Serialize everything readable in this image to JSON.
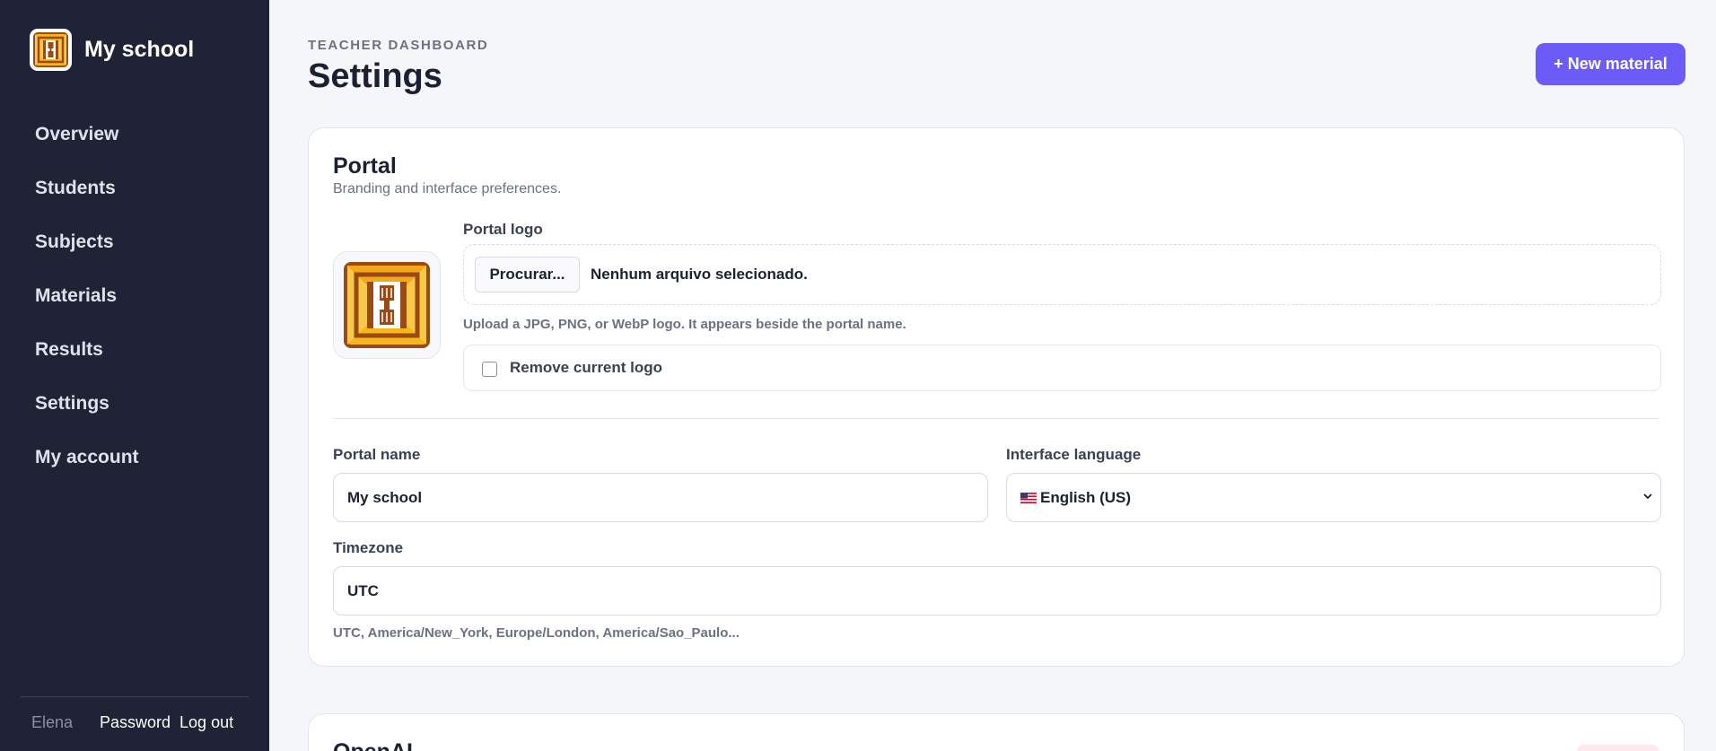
{
  "sidebar": {
    "brand_name": "My school",
    "items": [
      {
        "label": "Overview"
      },
      {
        "label": "Students"
      },
      {
        "label": "Subjects"
      },
      {
        "label": "Materials"
      },
      {
        "label": "Results"
      },
      {
        "label": "Settings"
      },
      {
        "label": "My account"
      }
    ],
    "footer": {
      "user": "Elena",
      "password_link": "Password",
      "logout_link": "Log out"
    }
  },
  "header": {
    "eyebrow": "TEACHER DASHBOARD",
    "title": "Settings",
    "new_button": "+ New material"
  },
  "portal": {
    "title": "Portal",
    "subtitle": "Branding and interface preferences.",
    "logo_label": "Portal logo",
    "browse_button": "Procurar...",
    "file_status": "Nenhum arquivo selecionado.",
    "logo_hint": "Upload a JPG, PNG, or WebP logo. It appears beside the portal name.",
    "remove_logo_label": "Remove current logo",
    "remove_logo_checked": false,
    "name_label": "Portal name",
    "name_value": "My school",
    "language_label": "Interface language",
    "language_value": "English (US)",
    "timezone_label": "Timezone",
    "timezone_value": "UTC",
    "timezone_hint": "UTC, America/New_York, Europe/London, America/Sao_Paulo..."
  },
  "openai": {
    "title": "OpenAI"
  },
  "icons": {
    "brand_logo": "school-logo-icon",
    "flag": "us-flag-icon",
    "chevron": "chevron-down-icon"
  },
  "colors": {
    "sidebar_bg": "#1f2335",
    "accent": "#6c5cf7",
    "page_bg": "#f5f6fa",
    "logo_gold": "#f5b71c",
    "logo_brown": "#9a4a12"
  }
}
